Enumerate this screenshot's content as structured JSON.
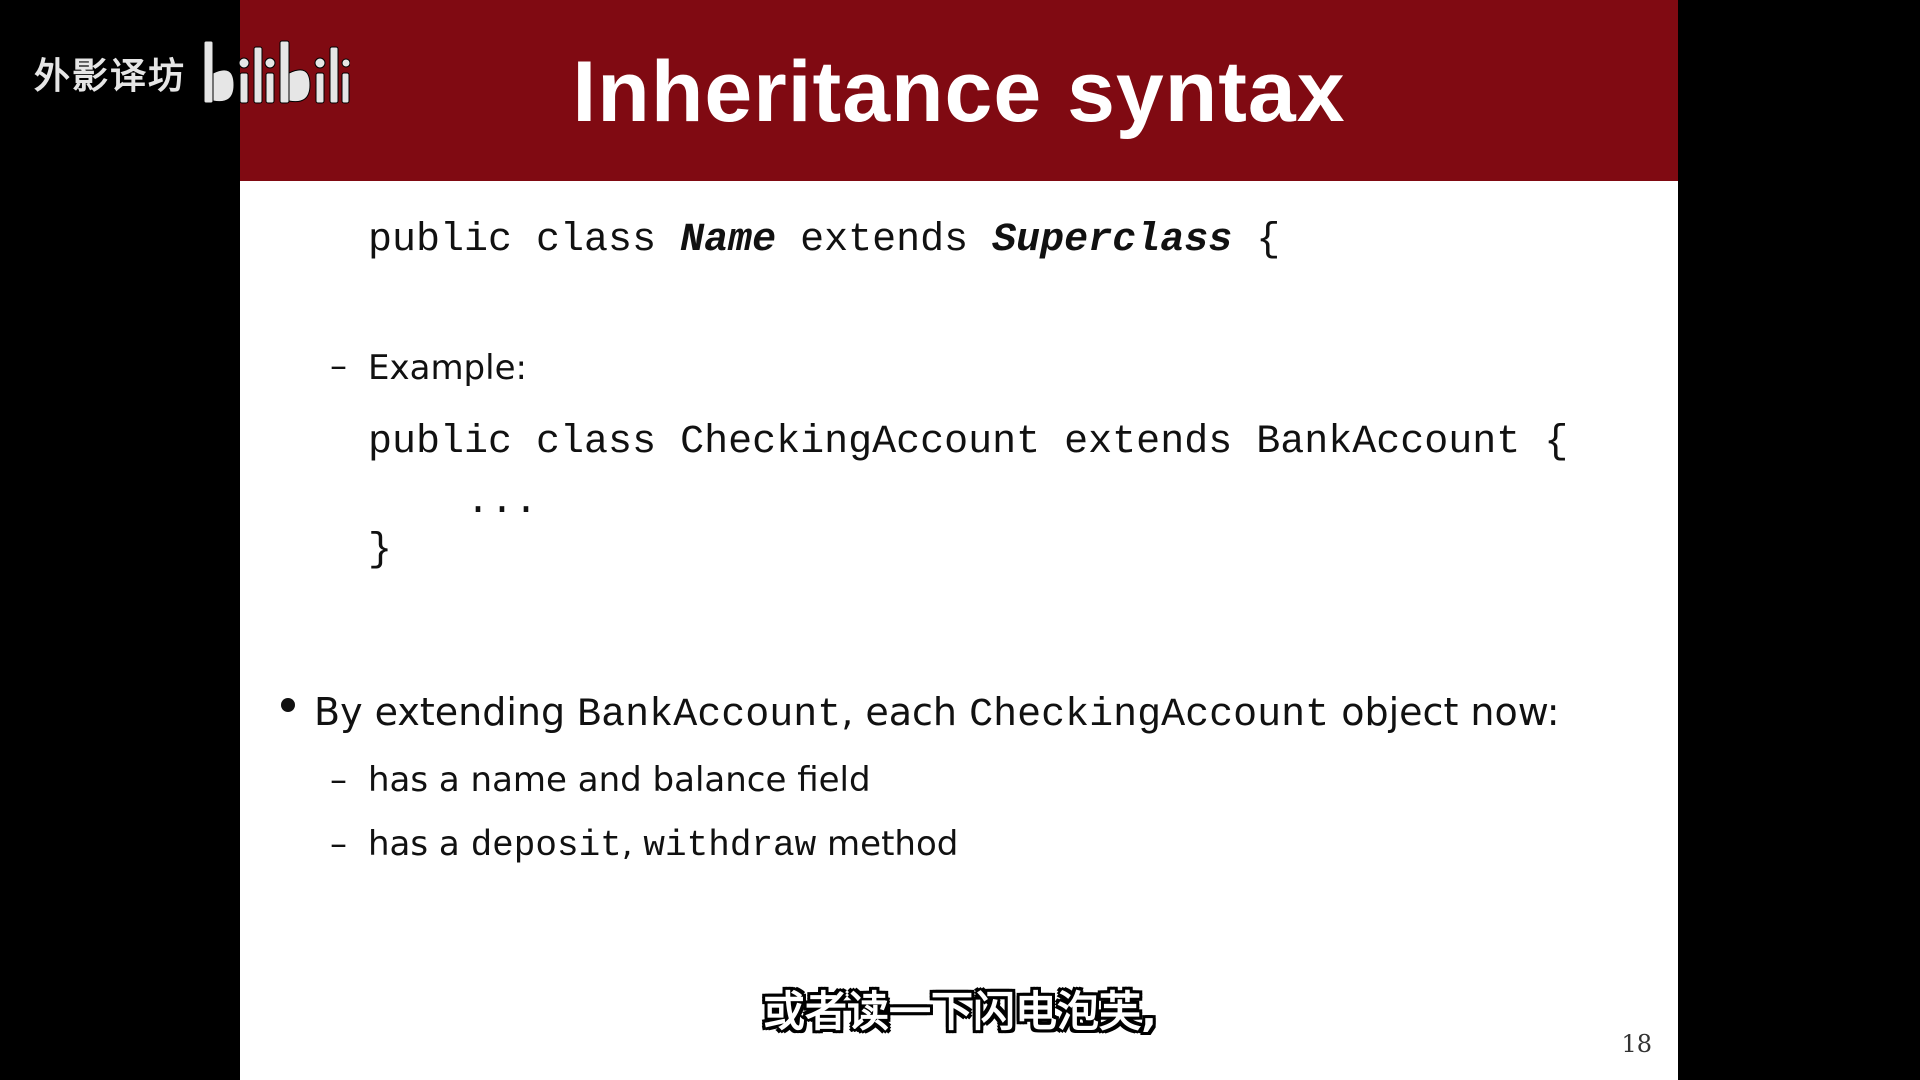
{
  "watermark": {
    "text": "外影译坊",
    "logo_icon": "bilibili-logo-icon"
  },
  "slide": {
    "title": "Inheritance syntax",
    "syntax": {
      "kw_public": "public",
      "kw_class": "class",
      "name": "Name",
      "kw_extends": "extends",
      "superclass": "Superclass",
      "brace_open": "{"
    },
    "example": {
      "dash": "–",
      "label": "Example:",
      "line1_public": "public",
      "line1_class": "class",
      "line1_name": "CheckingAccount",
      "line1_extends": "extends",
      "line1_super": "BankAccount",
      "line1_brace": "{",
      "line2": "...",
      "line3": "}"
    },
    "bullet": {
      "part1": "By extending ",
      "code1": "BankAccount",
      "part2": ", each ",
      "code2": "CheckingAccount",
      "part3": " object now:"
    },
    "sub1": {
      "dash": "–",
      "text": "has a name and balance field"
    },
    "sub2": {
      "dash": "–",
      "part1": "has a ",
      "code1": "deposit",
      "part2": ", ",
      "code2": "withdraw",
      "part3": " method"
    },
    "page_number": "18"
  },
  "caption": {
    "text": "或者读一下闪电泡芙,"
  },
  "colors": {
    "title_bar": "#800a12",
    "slide_bg": "#ffffff",
    "frame_bg": "#000000",
    "text": "#111111"
  }
}
